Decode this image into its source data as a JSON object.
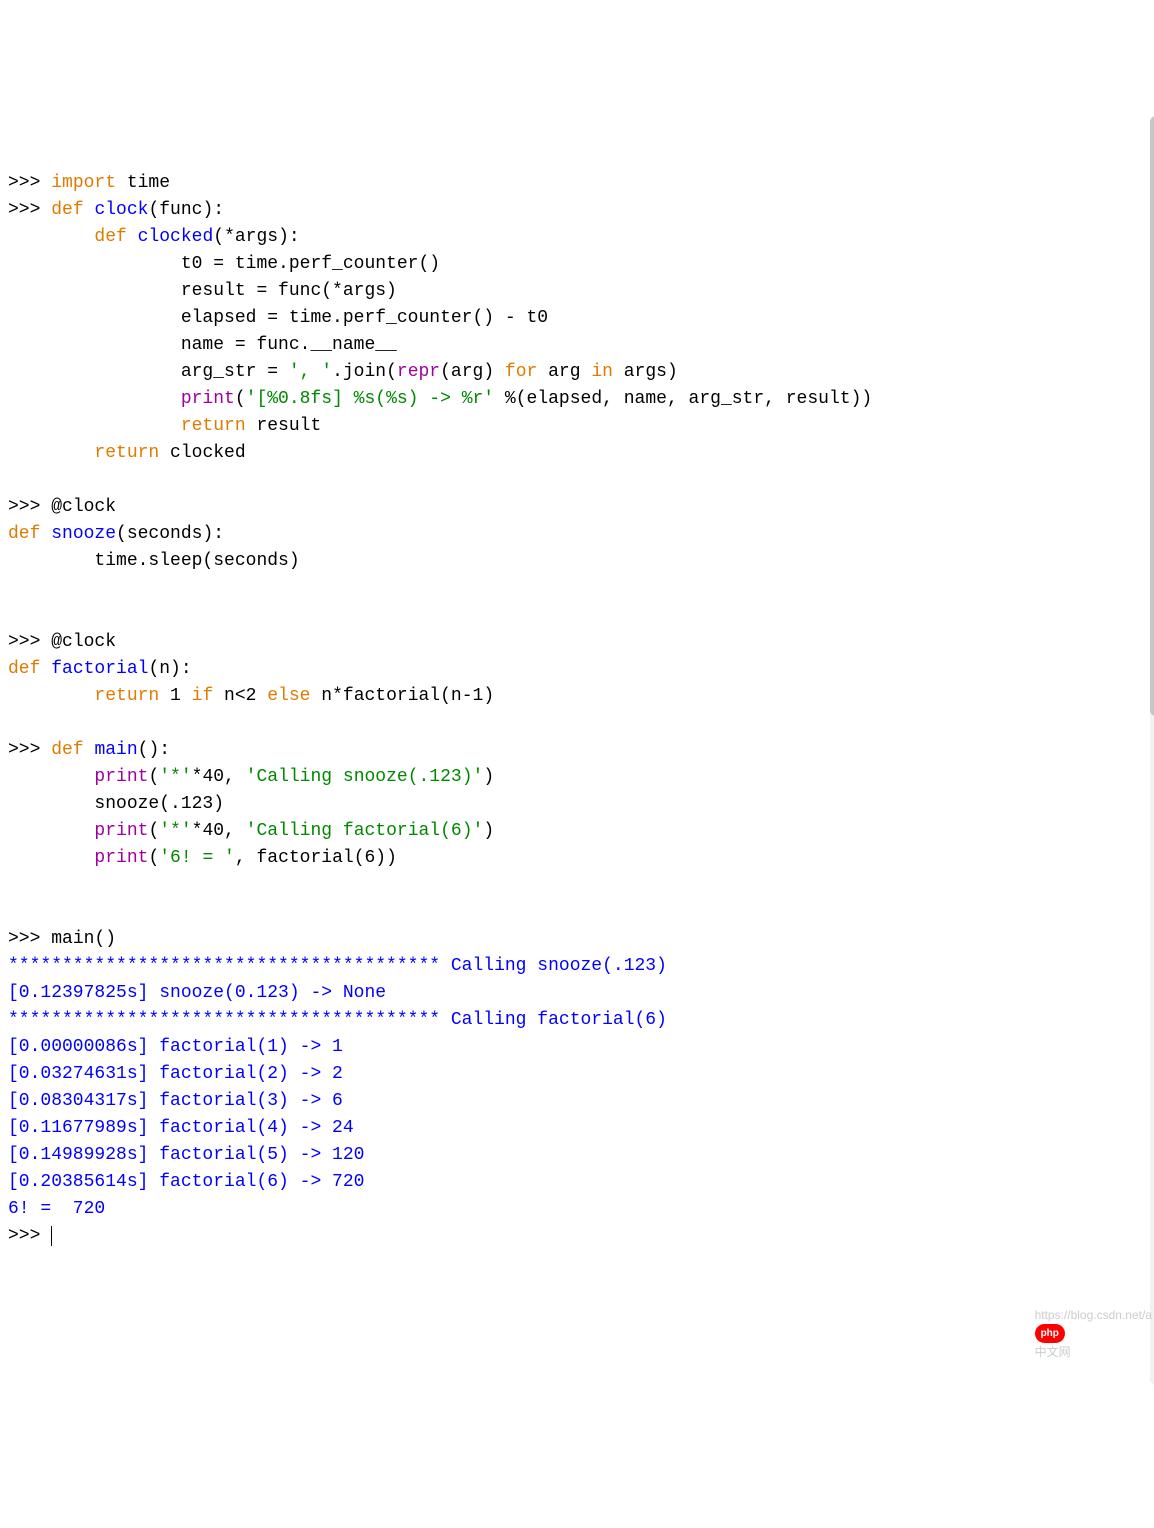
{
  "colors": {
    "keyword": "#e07b00",
    "funcname": "#0000ff",
    "builtin": "#a000a0",
    "string": "#008800",
    "prompt": "#000000",
    "output": "#0000ff",
    "default": "#000000"
  },
  "watermark_text": "中文网",
  "watermark_badge": "php",
  "watermark_url_hint": "https://blog.csdn.net/a",
  "lines": [
    [
      {
        "c": "prompt",
        "t": ">>> "
      },
      {
        "c": "keyword",
        "t": "import"
      },
      {
        "c": "default",
        "t": " time"
      }
    ],
    [
      {
        "c": "prompt",
        "t": ">>> "
      },
      {
        "c": "keyword",
        "t": "def"
      },
      {
        "c": "default",
        "t": " "
      },
      {
        "c": "funcname",
        "t": "clock"
      },
      {
        "c": "default",
        "t": "(func):"
      }
    ],
    [
      {
        "c": "default",
        "t": "        "
      },
      {
        "c": "keyword",
        "t": "def"
      },
      {
        "c": "default",
        "t": " "
      },
      {
        "c": "funcname",
        "t": "clocked"
      },
      {
        "c": "default",
        "t": "(*args):"
      }
    ],
    [
      {
        "c": "default",
        "t": "                t0 = time.perf_counter()"
      }
    ],
    [
      {
        "c": "default",
        "t": "                result = func(*args)"
      }
    ],
    [
      {
        "c": "default",
        "t": "                elapsed = time.perf_counter() - t0"
      }
    ],
    [
      {
        "c": "default",
        "t": "                name = func.__name__"
      }
    ],
    [
      {
        "c": "default",
        "t": "                arg_str = "
      },
      {
        "c": "string",
        "t": "', '"
      },
      {
        "c": "default",
        "t": ".join("
      },
      {
        "c": "builtin",
        "t": "repr"
      },
      {
        "c": "default",
        "t": "(arg) "
      },
      {
        "c": "keyword",
        "t": "for"
      },
      {
        "c": "default",
        "t": " arg "
      },
      {
        "c": "keyword",
        "t": "in"
      },
      {
        "c": "default",
        "t": " args)"
      }
    ],
    [
      {
        "c": "default",
        "t": "                "
      },
      {
        "c": "builtin",
        "t": "print"
      },
      {
        "c": "default",
        "t": "("
      },
      {
        "c": "string",
        "t": "'[%0.8fs] %s(%s) -> %r'"
      },
      {
        "c": "default",
        "t": " %(elapsed, name, arg_str, result))"
      }
    ],
    [
      {
        "c": "default",
        "t": "                "
      },
      {
        "c": "keyword",
        "t": "return"
      },
      {
        "c": "default",
        "t": " result"
      }
    ],
    [
      {
        "c": "default",
        "t": "        "
      },
      {
        "c": "keyword",
        "t": "return"
      },
      {
        "c": "default",
        "t": " clocked"
      }
    ],
    [
      {
        "c": "default",
        "t": ""
      }
    ],
    [
      {
        "c": "prompt",
        "t": ">>> "
      },
      {
        "c": "default",
        "t": "@clock"
      }
    ],
    [
      {
        "c": "keyword",
        "t": "def"
      },
      {
        "c": "default",
        "t": " "
      },
      {
        "c": "funcname",
        "t": "snooze"
      },
      {
        "c": "default",
        "t": "(seconds):"
      }
    ],
    [
      {
        "c": "default",
        "t": "        time.sleep(seconds)"
      }
    ],
    [
      {
        "c": "default",
        "t": ""
      }
    ],
    [
      {
        "c": "default",
        "t": "        "
      }
    ],
    [
      {
        "c": "prompt",
        "t": ">>> "
      },
      {
        "c": "default",
        "t": "@clock"
      }
    ],
    [
      {
        "c": "keyword",
        "t": "def"
      },
      {
        "c": "default",
        "t": " "
      },
      {
        "c": "funcname",
        "t": "factorial"
      },
      {
        "c": "default",
        "t": "(n):"
      }
    ],
    [
      {
        "c": "default",
        "t": "        "
      },
      {
        "c": "keyword",
        "t": "return"
      },
      {
        "c": "default",
        "t": " 1 "
      },
      {
        "c": "keyword",
        "t": "if"
      },
      {
        "c": "default",
        "t": " n<2 "
      },
      {
        "c": "keyword",
        "t": "else"
      },
      {
        "c": "default",
        "t": " n*factorial(n-1)"
      }
    ],
    [
      {
        "c": "default",
        "t": ""
      }
    ],
    [
      {
        "c": "prompt",
        "t": ">>> "
      },
      {
        "c": "keyword",
        "t": "def"
      },
      {
        "c": "default",
        "t": " "
      },
      {
        "c": "funcname",
        "t": "main"
      },
      {
        "c": "default",
        "t": "():"
      }
    ],
    [
      {
        "c": "default",
        "t": "        "
      },
      {
        "c": "builtin",
        "t": "print"
      },
      {
        "c": "default",
        "t": "("
      },
      {
        "c": "string",
        "t": "'*'"
      },
      {
        "c": "default",
        "t": "*40, "
      },
      {
        "c": "string",
        "t": "'Calling snooze(.123)'"
      },
      {
        "c": "default",
        "t": ")"
      }
    ],
    [
      {
        "c": "default",
        "t": "        snooze(.123)"
      }
    ],
    [
      {
        "c": "default",
        "t": "        "
      },
      {
        "c": "builtin",
        "t": "print"
      },
      {
        "c": "default",
        "t": "("
      },
      {
        "c": "string",
        "t": "'*'"
      },
      {
        "c": "default",
        "t": "*40, "
      },
      {
        "c": "string",
        "t": "'Calling factorial(6)'"
      },
      {
        "c": "default",
        "t": ")"
      }
    ],
    [
      {
        "c": "default",
        "t": "        "
      },
      {
        "c": "builtin",
        "t": "print"
      },
      {
        "c": "default",
        "t": "("
      },
      {
        "c": "string",
        "t": "'6! = '"
      },
      {
        "c": "default",
        "t": ", factorial(6))"
      }
    ],
    [
      {
        "c": "default",
        "t": ""
      }
    ],
    [
      {
        "c": "default",
        "t": "        "
      }
    ],
    [
      {
        "c": "prompt",
        "t": ">>> "
      },
      {
        "c": "default",
        "t": "main()"
      }
    ],
    [
      {
        "c": "output",
        "t": "**************************************** Calling snooze(.123)"
      }
    ],
    [
      {
        "c": "output",
        "t": "[0.12397825s] snooze(0.123) -> None"
      }
    ],
    [
      {
        "c": "output",
        "t": "**************************************** Calling factorial(6)"
      }
    ],
    [
      {
        "c": "output",
        "t": "[0.00000086s] factorial(1) -> 1"
      }
    ],
    [
      {
        "c": "output",
        "t": "[0.03274631s] factorial(2) -> 2"
      }
    ],
    [
      {
        "c": "output",
        "t": "[0.08304317s] factorial(3) -> 6"
      }
    ],
    [
      {
        "c": "output",
        "t": "[0.11677989s] factorial(4) -> 24"
      }
    ],
    [
      {
        "c": "output",
        "t": "[0.14989928s] factorial(5) -> 120"
      }
    ],
    [
      {
        "c": "output",
        "t": "[0.20385614s] factorial(6) -> 720"
      }
    ],
    [
      {
        "c": "output",
        "t": "6! =  720"
      }
    ],
    [
      {
        "c": "prompt",
        "t": ">>> "
      },
      {
        "c": "cursor",
        "t": ""
      }
    ]
  ]
}
